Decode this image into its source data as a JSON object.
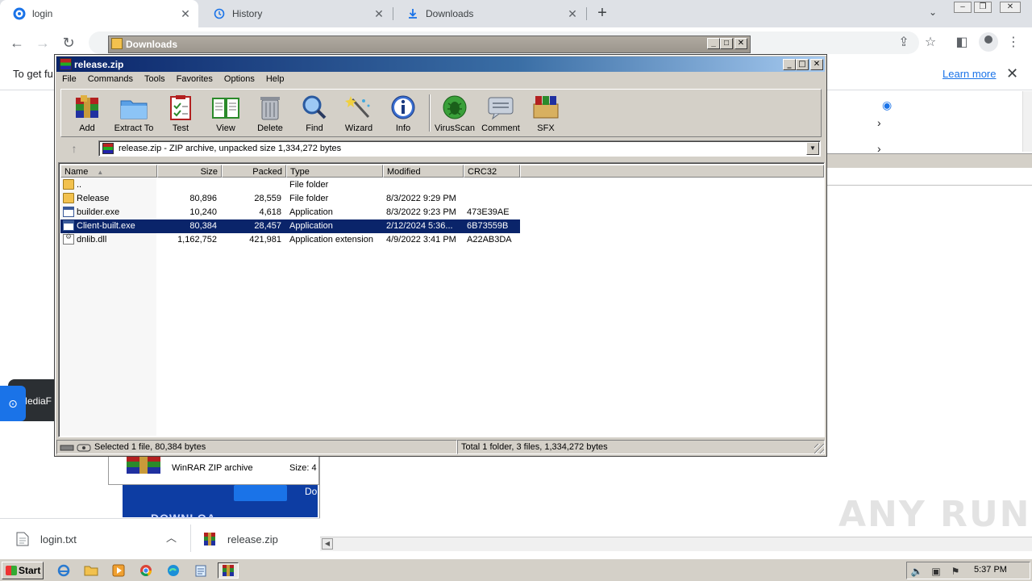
{
  "browser": {
    "tabs": [
      {
        "title": "login",
        "active": true,
        "icon": "edge-like-icon"
      },
      {
        "title": "History",
        "active": false,
        "icon": "history-icon"
      },
      {
        "title": "Downloads",
        "active": false,
        "icon": "download-icon"
      }
    ],
    "infobar": {
      "text": "To get fu",
      "learn_more": "Learn more"
    }
  },
  "background_page": {
    "mediafire_text": "MediaF",
    "winrar_row_label": "WinRAR ZIP archive",
    "size_label": "Size: 4",
    "download_text": "DOWNLOA",
    "do_text": "Do"
  },
  "download_shelf": {
    "items": [
      {
        "name": "login.txt"
      },
      {
        "name": "release.zip"
      }
    ]
  },
  "explorer_window": {
    "title": "Downloads"
  },
  "winrar": {
    "title": "release.zip",
    "menu": [
      "File",
      "Commands",
      "Tools",
      "Favorites",
      "Options",
      "Help"
    ],
    "toolbar": [
      "Add",
      "Extract To",
      "Test",
      "View",
      "Delete",
      "Find",
      "Wizard",
      "Info",
      "VirusScan",
      "Comment",
      "SFX"
    ],
    "address": "release.zip - ZIP archive, unpacked size 1,334,272 bytes",
    "columns": [
      "Name",
      "Size",
      "Packed",
      "Type",
      "Modified",
      "CRC32"
    ],
    "rows": [
      {
        "name": "..",
        "size": "",
        "packed": "",
        "type": "File folder",
        "modified": "",
        "crc": "",
        "icon": "folder"
      },
      {
        "name": "Release",
        "size": "80,896",
        "packed": "28,559",
        "type": "File folder",
        "modified": "8/3/2022 9:29 PM",
        "crc": "",
        "icon": "folder"
      },
      {
        "name": "builder.exe",
        "size": "10,240",
        "packed": "4,618",
        "type": "Application",
        "modified": "8/3/2022 9:23 PM",
        "crc": "473E39AE",
        "icon": "exe"
      },
      {
        "name": "Client-built.exe",
        "size": "80,384",
        "packed": "28,457",
        "type": "Application",
        "modified": "2/12/2024 5:36...",
        "crc": "6B73559B",
        "icon": "exe",
        "selected": true
      },
      {
        "name": "dnlib.dll",
        "size": "1,162,752",
        "packed": "421,981",
        "type": "Application extension",
        "modified": "4/9/2022 3:41 PM",
        "crc": "A22AB3DA",
        "icon": "dll"
      }
    ],
    "status_left": "Selected 1 file, 80,384 bytes",
    "status_right": "Total 1 folder, 3 files, 1,334,272 bytes"
  },
  "taskbar": {
    "start_label": "Start",
    "clock": "5:37 PM"
  },
  "watermark": "ANY RUN",
  "colors": {
    "winrar_titlebar": "#0a246a",
    "selection": "#0a246a",
    "link": "#1a73e8"
  }
}
